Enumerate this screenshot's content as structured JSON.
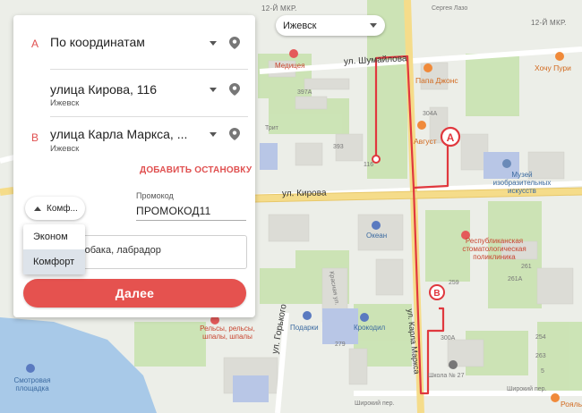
{
  "city_selector": {
    "value": "Ижевск"
  },
  "route": {
    "points": [
      {
        "letter": "A",
        "address": "По координатам",
        "city": ""
      },
      {
        "letter": "",
        "address": "улица Кирова, 116",
        "city": "Ижевск"
      },
      {
        "letter": "B",
        "address": "улица Карла Маркса, ...",
        "city": "Ижевск"
      }
    ],
    "add_stop_label": "ДОБАВИТЬ ОСТАНОВКУ"
  },
  "tariff": {
    "selected_label": "Комф...",
    "options": [
      "Эконом",
      "Комфорт"
    ],
    "selected_index": 1
  },
  "promo": {
    "label": "Промокод",
    "value": "ПРОМОКОД11"
  },
  "comment": {
    "value": "собака, лабрадор"
  },
  "submit_label": "Далее",
  "colors": {
    "accent": "#e5524f",
    "route": "#e0383e",
    "menu_selected": "#dde3ea"
  },
  "map": {
    "streets": [
      "ул. Кирова",
      "ул. Шумайлова",
      "ул. Горького",
      "ул. Карла Маркса",
      "Широкий пер.",
      "Красная ул."
    ],
    "districts": [
      "12-Й МКР.",
      "12-Й МКР."
    ],
    "pois": [
      {
        "name": "Медицея",
        "color": "red"
      },
      {
        "name": "Папа Джонс",
        "color": "orange"
      },
      {
        "name": "Хочу Пури",
        "color": "orange"
      },
      {
        "name": "Август",
        "color": "orange"
      },
      {
        "name": "Музей изобразительных искусств",
        "color": "blue"
      },
      {
        "name": "Трит",
        "color": "gray"
      },
      {
        "name": "Океан",
        "color": "blue"
      },
      {
        "name": "Республиканская стоматологическая поликлиника",
        "color": "red"
      },
      {
        "name": "Подарки",
        "color": "blue"
      },
      {
        "name": "Крокодил",
        "color": "blue"
      },
      {
        "name": "Рельсы, рельсы, шпалы, шпалы",
        "color": "red"
      },
      {
        "name": "Смотровая площадка",
        "color": "blue"
      },
      {
        "name": "Школа № 27",
        "color": "gray"
      },
      {
        "name": "Рояль",
        "color": "orange"
      },
      {
        "name": "Сергея Лазо",
        "color": "gray"
      }
    ],
    "houses": [
      "397А",
      "393",
      "116",
      "304А",
      "259",
      "261",
      "261А",
      "279",
      "263",
      "300А",
      "254",
      "5"
    ],
    "markers": [
      "A",
      "B"
    ]
  }
}
